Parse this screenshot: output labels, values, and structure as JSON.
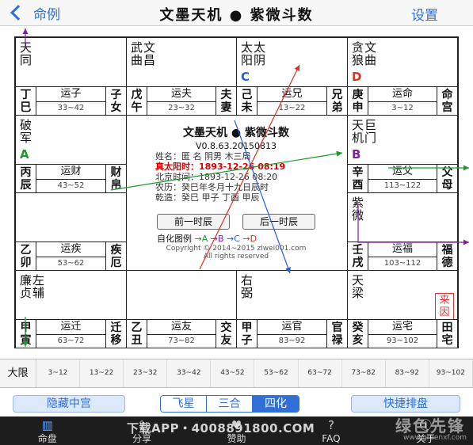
{
  "nav": {
    "back_label": "命例",
    "title": "文墨天机 ● 紫微斗数",
    "settings_label": "设置"
  },
  "colors": {
    "accent": "#2f6fd6",
    "a": "#1a9a2a",
    "b": "#7a1fa8",
    "c": "#2060e0",
    "d": "#e03020"
  },
  "palaces": [
    {
      "id": "si",
      "stars": [
        "天同"
      ],
      "mutagen": "",
      "gz": [
        "丁",
        "巳"
      ],
      "yun": "运子",
      "range": "33~42",
      "palace": [
        "子",
        "女"
      ]
    },
    {
      "id": "wu",
      "stars": [
        "武曲",
        "文昌"
      ],
      "mutagen": "",
      "gz": [
        "戊",
        "午"
      ],
      "yun": "运夫",
      "range": "23~32",
      "palace": [
        "夫",
        "妻"
      ]
    },
    {
      "id": "wei",
      "stars": [
        "太阳",
        "太阴"
      ],
      "mutagen": "C",
      "gz": [
        "己",
        "未"
      ],
      "yun": "运兄",
      "range": "13~22",
      "palace": [
        "兄",
        "弟"
      ]
    },
    {
      "id": "shen",
      "stars": [
        "贪狼",
        "文曲"
      ],
      "mutagen": "D",
      "gz": [
        "庚",
        "申"
      ],
      "yun": "运命",
      "range": "3~12",
      "palace": [
        "命",
        "宫"
      ]
    },
    {
      "id": "chen",
      "stars": [
        "破军"
      ],
      "mutagen": "A",
      "gz": [
        "丙",
        "辰"
      ],
      "yun": "运财",
      "range": "43~52",
      "palace": [
        "财",
        "帛"
      ]
    },
    {
      "id": "you",
      "stars": [
        "天机",
        "巨门"
      ],
      "mutagen": "B",
      "gz": [
        "辛",
        "酉"
      ],
      "yun": "运父",
      "range": "113~122",
      "palace": [
        "父",
        "母"
      ]
    },
    {
      "id": "mao",
      "stars": [],
      "mutagen": "",
      "gz": [
        "乙",
        "卯"
      ],
      "yun": "运疾",
      "range": "53~62",
      "palace": [
        "疾",
        "厄"
      ]
    },
    {
      "id": "xu",
      "stars": [
        "紫微"
      ],
      "mutagen": "",
      "gz": [
        "壬",
        "戌"
      ],
      "yun": "运福",
      "range": "103~112",
      "palace": [
        "福",
        "德"
      ]
    },
    {
      "id": "yin",
      "stars": [
        "廉贞",
        "左辅"
      ],
      "mutagen": "",
      "gz": [
        "甲",
        "寅"
      ],
      "yun": "运迁",
      "range": "63~72",
      "palace": [
        "迁",
        "移"
      ]
    },
    {
      "id": "chou",
      "stars": [],
      "mutagen": "",
      "gz": [
        "乙",
        "丑"
      ],
      "yun": "运友",
      "range": "73~82",
      "palace": [
        "交",
        "友"
      ]
    },
    {
      "id": "zi",
      "stars": [
        "右弼"
      ],
      "mutagen": "",
      "gz": [
        "甲",
        "子"
      ],
      "yun": "运官",
      "range": "83~92",
      "palace": [
        "官",
        "禄"
      ]
    },
    {
      "id": "hai",
      "stars": [
        "天梁"
      ],
      "mutagen": "",
      "gz": [
        "癸",
        "亥"
      ],
      "yun": "运宅",
      "range": "93~102",
      "palace": [
        "田",
        "宅"
      ],
      "stamp": "来因"
    }
  ],
  "center": {
    "title": "文墨天机 ● 紫微斗数",
    "version": "V0.8.63.20150813",
    "line_name": "姓名：匿 名          阴男 木三局",
    "line_solar": "真太阳时：1893-12-26   08:19",
    "line_beijing": "北京时间：1893-12-26   08:20",
    "line_lunar": "农历：癸巳年冬月十九日辰时",
    "line_bazi": "乾造：癸巳  甲子  丁酉  甲辰",
    "prev_hour": "前一时辰",
    "next_hour": "后一时辰",
    "legend_label": "自化图例",
    "legend_a": "→A",
    "legend_b": "→B",
    "legend_c": "→C",
    "legend_d": "→D",
    "copyright": "Copyright © 2014~2015 ziwei001.com",
    "rights": "All rights reserved"
  },
  "daxian": {
    "label": "大限",
    "ranges": [
      "3~12",
      "13~22",
      "23~32",
      "33~42",
      "43~52",
      "53~62",
      "63~72",
      "73~82",
      "83~92",
      "93~102"
    ]
  },
  "controls": {
    "hide_label": "隐藏中宫",
    "segments": [
      "飞星",
      "三合",
      "四化"
    ],
    "active_segment": 2,
    "quick_label": "快捷排盘"
  },
  "tabs": [
    {
      "label": "命盘",
      "icon": "chart-icon"
    },
    {
      "label": "分享",
      "icon": "share-icon"
    },
    {
      "label": "赞助",
      "icon": "sponsor-icon"
    },
    {
      "label": "FAQ",
      "icon": "faq-icon"
    },
    {
      "label": "关于",
      "icon": "about-icon"
    }
  ],
  "watermark": {
    "app_text": "下载APP・4008891800.COM",
    "logo": "绿色先锋",
    "site": "www.greenxf.com"
  }
}
